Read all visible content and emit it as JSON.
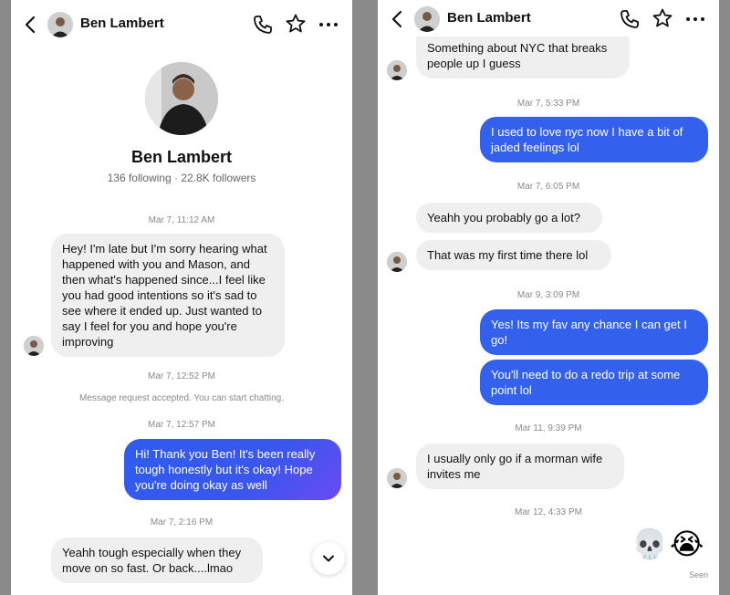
{
  "contact": {
    "name": "Ben Lambert",
    "meta": "136 following · 22.8K followers"
  },
  "left": {
    "ts1": "Mar 7, 11:12 AM",
    "msg1": "Hey! I'm late but I'm sorry hearing what happened with you and Mason, and then what's happened since...I feel like you had good intentions so it's sad to see where it ended up. Just wanted to say I feel for you and hope you're improving",
    "ts2": "Mar 7, 12:52 PM",
    "system": "Message request accepted. You can start chatting.",
    "ts3": "Mar 7, 12:57 PM",
    "msg2": "Hi! Thank you Ben! It's been really tough honestly but it's okay! Hope you're doing okay as well",
    "ts4": "Mar 7, 2:16 PM",
    "msg3": "Yeahh tough especially when they move on so fast. Or back....lmao"
  },
  "right": {
    "msg1": "Something about NYC that breaks people up I guess",
    "ts1": "Mar 7, 5:33 PM",
    "msg2": "I used to love nyc now I have a bit of jaded feelings lol",
    "ts2": "Mar 7, 6:05 PM",
    "msg3": "Yeahh you probably go a lot?",
    "msg4": "That was my first time there lol",
    "ts3": "Mar 9, 3:09 PM",
    "msg5": "Yes! Its my fav any chance I can get I go!",
    "msg6": "You'll need to do a redo trip at some point lol",
    "ts4": "Mar 11, 9:39 PM",
    "msg7": "I usually only go if a morman wife invites me",
    "ts5": "Mar 12, 4:33 PM",
    "emoji1": "💀",
    "emoji2": "😭",
    "seen": "Seen"
  },
  "colors": {
    "outgoing": "#3460ee",
    "incoming": "#efefef"
  }
}
